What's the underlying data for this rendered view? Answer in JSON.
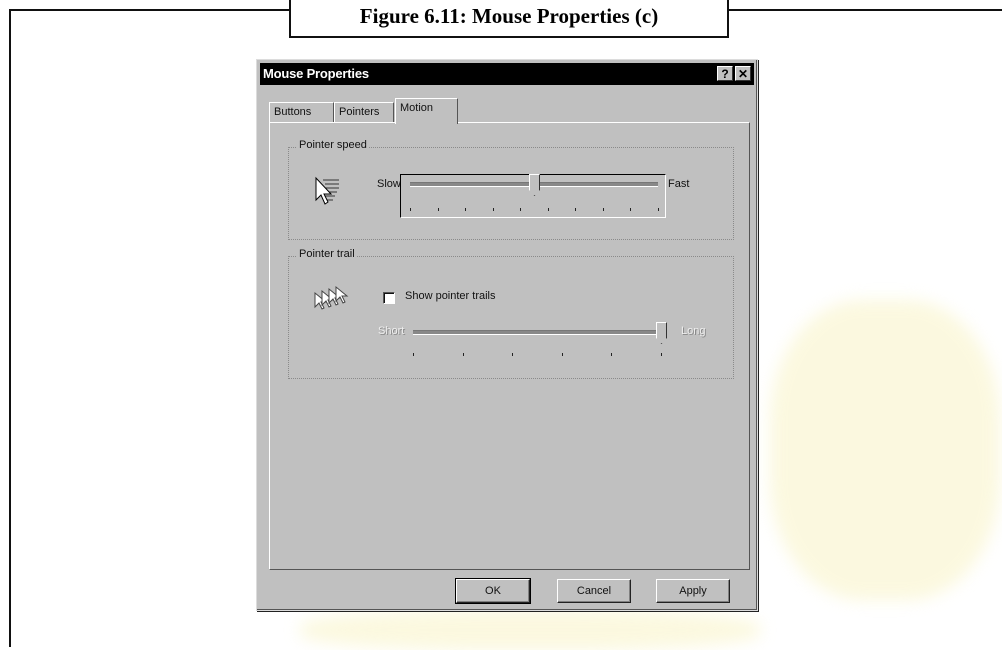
{
  "caption": "Figure 6.11: Mouse Properties (c)",
  "dialog": {
    "title": "Mouse Properties",
    "help_button": "?",
    "close_button": "✕",
    "tabs": [
      {
        "label": "Buttons",
        "active": false
      },
      {
        "label": "Pointers",
        "active": false
      },
      {
        "label": "Motion",
        "active": true
      }
    ],
    "pointer_speed": {
      "group_label": "Pointer speed",
      "slow_label": "Slow",
      "fast_label": "Fast",
      "level": 0.5,
      "icon": "pointer-speed-icon"
    },
    "pointer_trail": {
      "group_label": "Pointer trail",
      "checkbox_label": "Show pointer trails",
      "checked": false,
      "short_label": "Short",
      "long_label": "Long",
      "level": 1.0,
      "icon": "pointer-trail-icon"
    },
    "buttons": {
      "ok": "OK",
      "cancel": "Cancel",
      "apply": "Apply"
    }
  }
}
